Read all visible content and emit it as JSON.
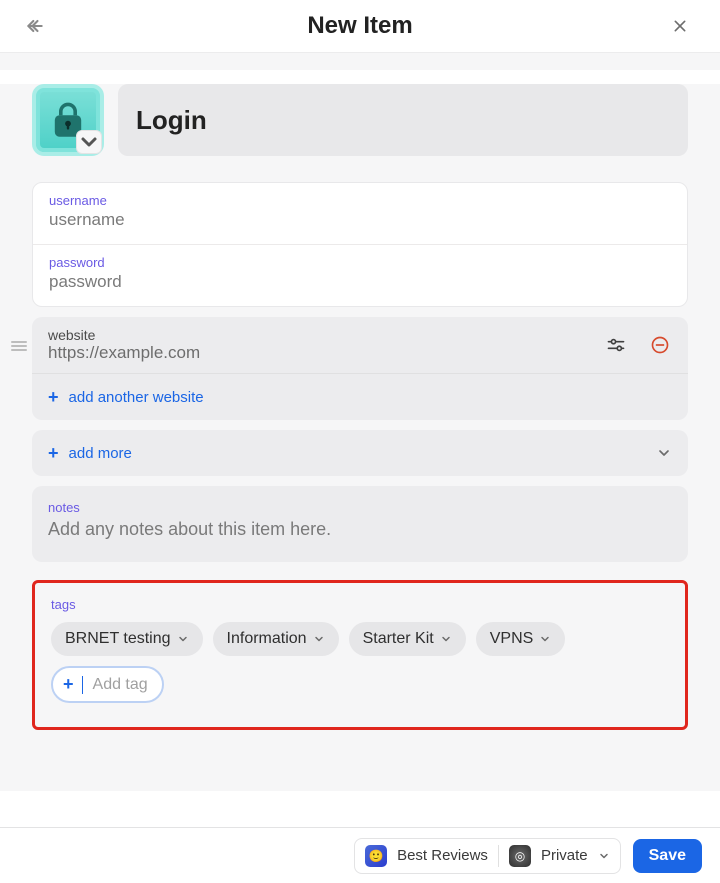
{
  "header": {
    "title": "New Item"
  },
  "itemTitle": "Login",
  "fields": {
    "username": {
      "label": "username",
      "value": "username"
    },
    "password": {
      "label": "password",
      "value": "password"
    }
  },
  "website": {
    "label": "website",
    "value": "https://example.com"
  },
  "links": {
    "addWebsite": "add another website",
    "addMore": "add more"
  },
  "notes": {
    "label": "notes",
    "placeholder": "Add any notes about this item here."
  },
  "tags": {
    "label": "tags",
    "items": [
      "BRNET testing",
      "Information",
      "Starter Kit",
      "VPNS"
    ],
    "addPlaceholder": "Add tag"
  },
  "footer": {
    "account": "Best Reviews",
    "vault": "Private",
    "save": "Save"
  }
}
